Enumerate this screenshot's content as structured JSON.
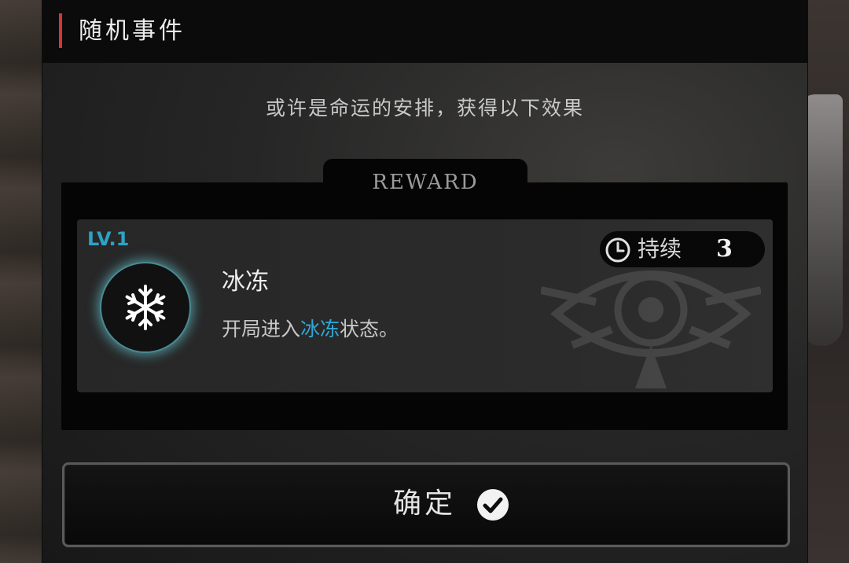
{
  "dialog": {
    "title": "随机事件",
    "subtitle": "或许是命运的安排，获得以下效果",
    "accent_color": "#d8343b"
  },
  "reward": {
    "section_label": "REWARD",
    "level": "LV.1",
    "icon": "snowflake-icon",
    "name": "冰冻",
    "description_prefix": "开局进入",
    "description_highlight": "冰冻",
    "description_suffix": "状态。",
    "highlight_color": "#2ea8d8",
    "duration_icon": "clock-icon",
    "duration_label": "持续",
    "duration_value": "3"
  },
  "confirm_button": {
    "label": "确定",
    "icon": "check-circle-icon"
  }
}
